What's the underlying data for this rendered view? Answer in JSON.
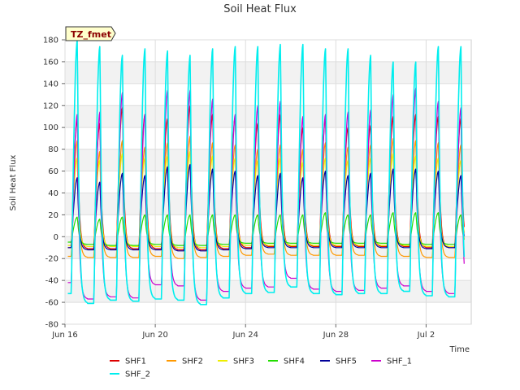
{
  "chart_data": {
    "type": "line",
    "title": "Soil Heat Flux",
    "xlabel": "Time",
    "ylabel": "Soil Heat Flux",
    "tag": "TZ_fmet",
    "ylim": [
      -80,
      180
    ],
    "yticks": [
      -80,
      -60,
      -40,
      -20,
      0,
      20,
      40,
      60,
      80,
      100,
      120,
      140,
      160,
      180
    ],
    "xlim": [
      "2023-06-16",
      "2023-07-04"
    ],
    "xticks": [
      {
        "date": "2023-06-16",
        "label": "Jun 16"
      },
      {
        "date": "2023-06-20",
        "label": "Jun 20"
      },
      {
        "date": "2023-06-24",
        "label": "Jun 24"
      },
      {
        "date": "2023-06-28",
        "label": "Jun 28"
      },
      {
        "date": "2023-07-02",
        "label": "Jul 2"
      }
    ],
    "grid": true,
    "legend_position": "bottom",
    "days": [
      "2023-06-16",
      "2023-06-17",
      "2023-06-18",
      "2023-06-19",
      "2023-06-20",
      "2023-06-21",
      "2023-06-22",
      "2023-06-23",
      "2023-06-24",
      "2023-06-25",
      "2023-06-26",
      "2023-06-27",
      "2023-06-28",
      "2023-06-29",
      "2023-06-30",
      "2023-07-01",
      "2023-07-02",
      "2023-07-03"
    ],
    "series": [
      {
        "name": "SHF1",
        "color": "#dd0000",
        "daily_min": [
          -10,
          -11,
          -11,
          -11,
          -11,
          -12,
          -12,
          -11,
          -10,
          -9,
          -9,
          -9,
          -9,
          -9,
          -9,
          -9,
          -10,
          -10
        ],
        "daily_max": [
          108,
          104,
          118,
          112,
          108,
          120,
          112,
          110,
          104,
          112,
          100,
          108,
          100,
          102,
          110,
          112,
          110,
          108
        ]
      },
      {
        "name": "SHF2",
        "color": "#ff9900",
        "daily_min": [
          -18,
          -19,
          -19,
          -19,
          -18,
          -20,
          -19,
          -18,
          -17,
          -16,
          -17,
          -17,
          -17,
          -17,
          -18,
          -18,
          -19,
          -19
        ],
        "daily_max": [
          88,
          78,
          88,
          82,
          86,
          92,
          86,
          84,
          80,
          84,
          80,
          86,
          82,
          84,
          90,
          88,
          86,
          84
        ]
      },
      {
        "name": "SHF3",
        "color": "#eeee00",
        "daily_min": [
          -8,
          -9,
          -9,
          -9,
          -9,
          -10,
          -10,
          -9,
          -8,
          -8,
          -8,
          -8,
          -8,
          -8,
          -8,
          -8,
          -9,
          -9
        ],
        "daily_max": [
          72,
          70,
          76,
          72,
          74,
          78,
          74,
          72,
          70,
          72,
          68,
          72,
          70,
          72,
          76,
          74,
          72,
          70
        ]
      },
      {
        "name": "SHF4",
        "color": "#22dd00",
        "daily_min": [
          -5,
          -7,
          -8,
          -8,
          -7,
          -8,
          -8,
          -7,
          -6,
          -6,
          -6,
          -6,
          -6,
          -6,
          -6,
          -7,
          -7,
          -7
        ],
        "daily_max": [
          18,
          16,
          18,
          20,
          20,
          20,
          20,
          20,
          20,
          20,
          20,
          22,
          20,
          20,
          22,
          22,
          22,
          20
        ]
      },
      {
        "name": "SHF5",
        "color": "#000099",
        "daily_min": [
          -10,
          -12,
          -12,
          -12,
          -12,
          -13,
          -13,
          -12,
          -11,
          -10,
          -10,
          -10,
          -10,
          -10,
          -10,
          -10,
          -11,
          -10
        ],
        "daily_max": [
          54,
          50,
          58,
          56,
          64,
          66,
          62,
          60,
          56,
          58,
          54,
          60,
          56,
          58,
          62,
          62,
          60,
          56
        ]
      },
      {
        "name": "SHF_1",
        "color": "#cc00cc",
        "daily_min": [
          -42,
          -57,
          -55,
          -56,
          -44,
          -45,
          -58,
          -50,
          -47,
          -46,
          -38,
          -48,
          -50,
          -49,
          -47,
          -45,
          -50,
          -52
        ],
        "daily_max": [
          112,
          114,
          132,
          112,
          134,
          134,
          126,
          112,
          120,
          124,
          110,
          112,
          114,
          116,
          130,
          136,
          124,
          118
        ]
      },
      {
        "name": "SHF_2",
        "color": "#00eeee",
        "daily_min": [
          -52,
          -61,
          -58,
          -59,
          -57,
          -58,
          -62,
          -56,
          -52,
          -51,
          -46,
          -52,
          -53,
          -52,
          -52,
          -50,
          -54,
          -55
        ],
        "daily_max": [
          180,
          174,
          166,
          172,
          170,
          166,
          172,
          174,
          174,
          176,
          176,
          172,
          172,
          166,
          160,
          160,
          174,
          174
        ]
      }
    ]
  }
}
